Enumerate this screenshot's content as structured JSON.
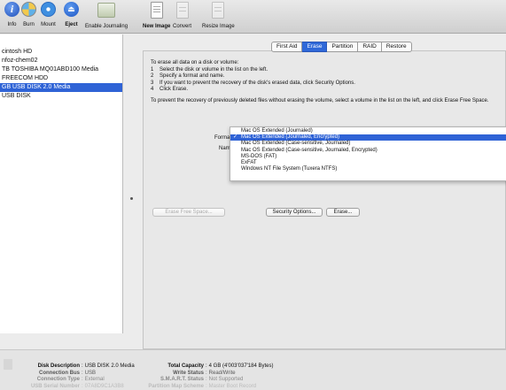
{
  "toolbar": {
    "items": [
      {
        "label": "Info",
        "icon": "info-icon"
      },
      {
        "label": "Burn",
        "icon": "burn-icon"
      },
      {
        "label": "Mount",
        "icon": "mount-icon"
      },
      {
        "label": "Eject",
        "icon": "eject-icon"
      },
      {
        "label": "Enable Journaling",
        "icon": "journaling-icon"
      },
      {
        "label": "New Image",
        "icon": "new-image-icon"
      },
      {
        "label": "Convert",
        "icon": "convert-icon"
      },
      {
        "label": "Resize Image",
        "icon": "resize-image-icon"
      }
    ]
  },
  "sidebar": {
    "items": [
      {
        "label": "cintosh HD"
      },
      {
        "label": "nfoz-chem02"
      },
      {
        "label": "TB TOSHIBA MQ01ABD100 Media"
      },
      {
        "label": "FREECOM HDD"
      },
      {
        "label": "GB USB DISK 2.0 Media",
        "selected": true
      },
      {
        "label": "USB DISK"
      }
    ]
  },
  "tabs": [
    {
      "label": "First Aid"
    },
    {
      "label": "Erase",
      "active": true
    },
    {
      "label": "Partition"
    },
    {
      "label": "RAID"
    },
    {
      "label": "Restore"
    }
  ],
  "instructions": {
    "intro": "To erase all data on a disk or volume:",
    "steps": [
      {
        "num": "1",
        "text": "Select the disk or volume in the list on the left."
      },
      {
        "num": "2",
        "text": "Specify a format and name."
      },
      {
        "num": "3",
        "text": "If you want to prevent the recovery of the disk's erased data, click Security Options."
      },
      {
        "num": "4",
        "text": "Click Erase."
      }
    ],
    "note": "To prevent the recovery of previously deleted files without erasing the volume, select a volume in the list on the left, and click Erase Free Space."
  },
  "form": {
    "format_label": "Format",
    "name_label": "Name"
  },
  "format_menu": {
    "selected_index": 1,
    "options": [
      "Mac OS Extended (Journaled)",
      "Mac OS Extended (Journaled, Encrypted)",
      "Mac OS Extended (Case-sensitive, Journaled)",
      "Mac OS Extended (Case-sensitive, Journaled, Encrypted)",
      "MS-DOS (FAT)",
      "ExFAT",
      "Windows NT File System (Tuxera NTFS)"
    ]
  },
  "buttons": {
    "erase_free_space": "Erase Free Space...",
    "security_options": "Security Options...",
    "erase": "Erase..."
  },
  "disk_info": {
    "left": [
      {
        "key": "Disk Description",
        "value": "USB DISK 2.0 Media"
      },
      {
        "key": "Connection Bus",
        "value": "USB"
      },
      {
        "key": "Connection Type",
        "value": "External"
      },
      {
        "key": "USB Serial Number",
        "value": "07A8D9C1A3B8"
      }
    ],
    "right": [
      {
        "key": "Total Capacity",
        "value": "4 GB (4'003'037'184 Bytes)"
      },
      {
        "key": "Write Status",
        "value": "Read/Write"
      },
      {
        "key": "S.M.A.R.T. Status",
        "value": "Not Supported"
      },
      {
        "key": "Partition Map Scheme",
        "value": "Master Boot Record"
      }
    ]
  },
  "colors": {
    "accent": "#2f63d6"
  }
}
